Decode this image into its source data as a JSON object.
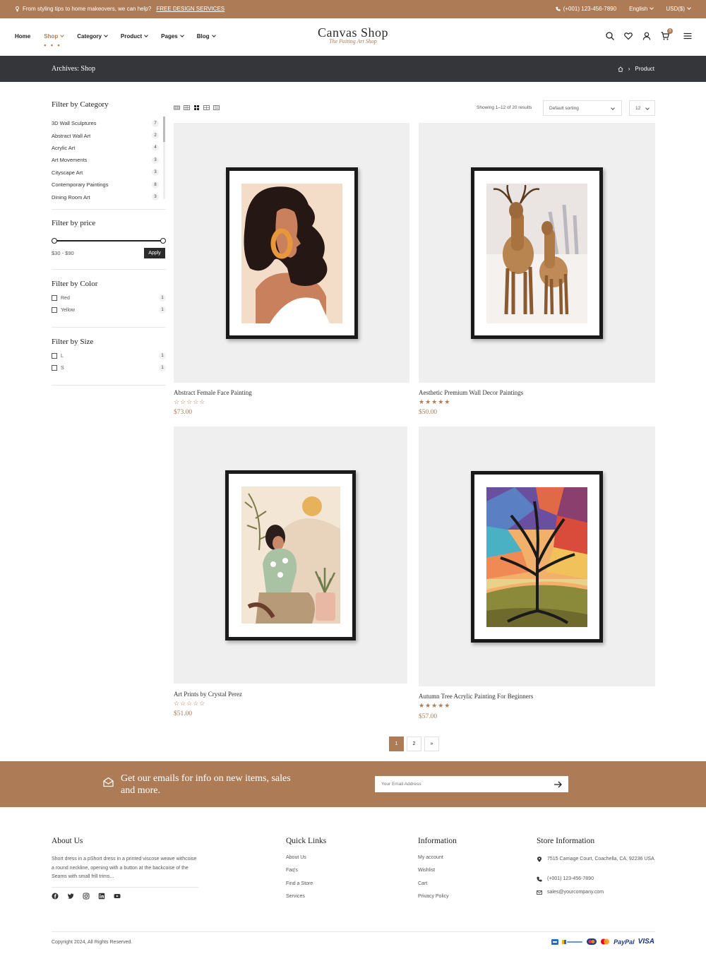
{
  "topbar": {
    "promo_text": "From styling tips to home makeovers, we can help?",
    "promo_link": "FREE DESIGN SERVICES",
    "phone": "(+001) 123-456-7890",
    "language": "English",
    "currency": "USD($)"
  },
  "nav": {
    "items": [
      {
        "label": "Home"
      },
      {
        "label": "Shop"
      },
      {
        "label": "Category"
      },
      {
        "label": "Product"
      },
      {
        "label": "Pages"
      },
      {
        "label": "Blog"
      }
    ],
    "active_dots": "• • •"
  },
  "logo": {
    "name": "Canvas Shop",
    "tagline": "The Paiting Art Shop"
  },
  "header": {
    "cart_count": "0"
  },
  "breadcrumb": {
    "title": "Archives: Shop",
    "separator": "›",
    "current": "Product"
  },
  "filters": {
    "category_title": "Filter by Category",
    "categories": [
      {
        "label": "3D Wall Sculptures",
        "count": "7"
      },
      {
        "label": "Abstract Wall Art",
        "count": "2"
      },
      {
        "label": "Acrylic Art",
        "count": "4"
      },
      {
        "label": "Art Movements",
        "count": "3"
      },
      {
        "label": "Cityscape Art",
        "count": "3"
      },
      {
        "label": "Contemporary Paintings",
        "count": "8"
      },
      {
        "label": "Dining Room Art",
        "count": "3"
      }
    ],
    "price_title": "Filter by price",
    "price_range": "$30 - $90",
    "apply_label": "Apply",
    "color_title": "Filter by Color",
    "colors": [
      {
        "label": "Red",
        "count": "1"
      },
      {
        "label": "Yellow",
        "count": "1"
      }
    ],
    "size_title": "Filter by Size",
    "sizes": [
      {
        "label": "L",
        "count": "1"
      },
      {
        "label": "S",
        "count": "1"
      }
    ]
  },
  "toolbar": {
    "showing": "Showing 1–12 of 20 results",
    "sort": "Default sorting",
    "per_page": "12"
  },
  "products": [
    {
      "name": "Abstract Female Face Painting",
      "stars": "☆☆☆☆☆",
      "rating": 0,
      "price": "$73.00"
    },
    {
      "name": "Aesthetic Premium Wall Decor Paintings",
      "stars": "★★★★★",
      "rating": 5,
      "price": "$50.00"
    },
    {
      "name": "Art Prints by Crystal Perez",
      "stars": "☆☆☆☆☆",
      "rating": 0,
      "price": "$51.00"
    },
    {
      "name": "Autumn Tree Acrylic Painting For Beginners",
      "stars": "★★★★★",
      "rating": 5,
      "price": "$57.00"
    }
  ],
  "pagination": {
    "pages": [
      "1",
      "2"
    ],
    "next": "»"
  },
  "newsletter": {
    "text": "Get our emails for info on new items, sales and more.",
    "placeholder": "Your Email Address"
  },
  "footer": {
    "about_title": "About Us",
    "about_text": "Short dress in a pShort dress in a printed viscose weave withcoise a round neckline, opening with a button at the backcoise of the Seams with small frill trims...",
    "quick_title": "Quick Links",
    "quick_links": [
      "About Us",
      "Faq's",
      "Find a Store",
      "Services"
    ],
    "info_title": "Information",
    "info_links": [
      "My account",
      "Wishlist",
      "Cart",
      "Privacy Policy"
    ],
    "store_title": "Store Information",
    "address": "7515 Carriage Court, Coachella, CA, 92236 USA",
    "phone": "(+001) 123-456-7890",
    "email": "sales@yourcompany.com",
    "copyright": "Copyright 2024, All Rights Reserved.",
    "payments": [
      "PayPal",
      "VISA"
    ]
  },
  "colors": {
    "accent": "#ad7c57",
    "dark_bar": "#35363a",
    "image_bg": "#efefef"
  }
}
